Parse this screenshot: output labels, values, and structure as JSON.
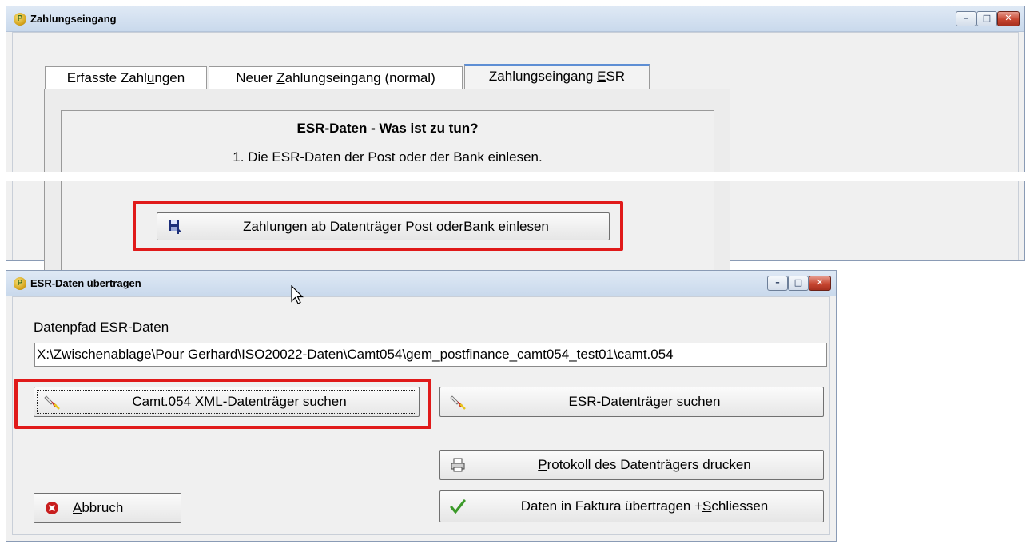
{
  "window1": {
    "title": "Zahlungseingang",
    "tabs": [
      {
        "pre": "Erfasste  Zahl",
        "ul": "u",
        "post": "ngen"
      },
      {
        "pre": "Neuer ",
        "ul": "Z",
        "post": "ahlungseingang (normal)"
      },
      {
        "pre": "Zahlungseingang ",
        "ul": "E",
        "post": "SR"
      }
    ],
    "heading": "ESR-Daten - Was ist zu tun?",
    "step1": "1. Die ESR-Daten der Post oder der Bank einlesen.",
    "read_button": {
      "pre": "Zahlungen ab Datenträger Post oder ",
      "ul": "B",
      "post": "ank einlesen"
    }
  },
  "window2": {
    "title": "ESR-Daten übertragen",
    "path_label": "Datenpfad ESR-Daten",
    "path_value": "X:\\Zwischenablage\\Pour Gerhard\\ISO20022-Daten\\Camt054\\gem_postfinance_camt054_test01\\camt.054",
    "camt_button": {
      "pre": "",
      "ul": "C",
      "post": "amt.054 XML-Datenträger suchen"
    },
    "esr_button": {
      "pre": "",
      "ul": "E",
      "post": "SR-Datenträger suchen"
    },
    "protocol_button": {
      "pre": "",
      "ul": "P",
      "post": "rotokoll des Datenträgers drucken"
    },
    "abort_button": {
      "pre": "",
      "ul": "A",
      "post": "bbruch"
    },
    "transfer_button": {
      "pre": "Daten in Faktura übertragen + ",
      "ul": "S",
      "post": "chliessen"
    }
  },
  "window_controls": {
    "minimize": "–",
    "maximize": "□",
    "close": "✕"
  },
  "colors": {
    "highlight": "#e01a1a",
    "titlebar": "#c9d9ec",
    "active_tab": "#5d8ed4",
    "ok": "#3c9a2a",
    "cancel": "#c81e1e"
  }
}
